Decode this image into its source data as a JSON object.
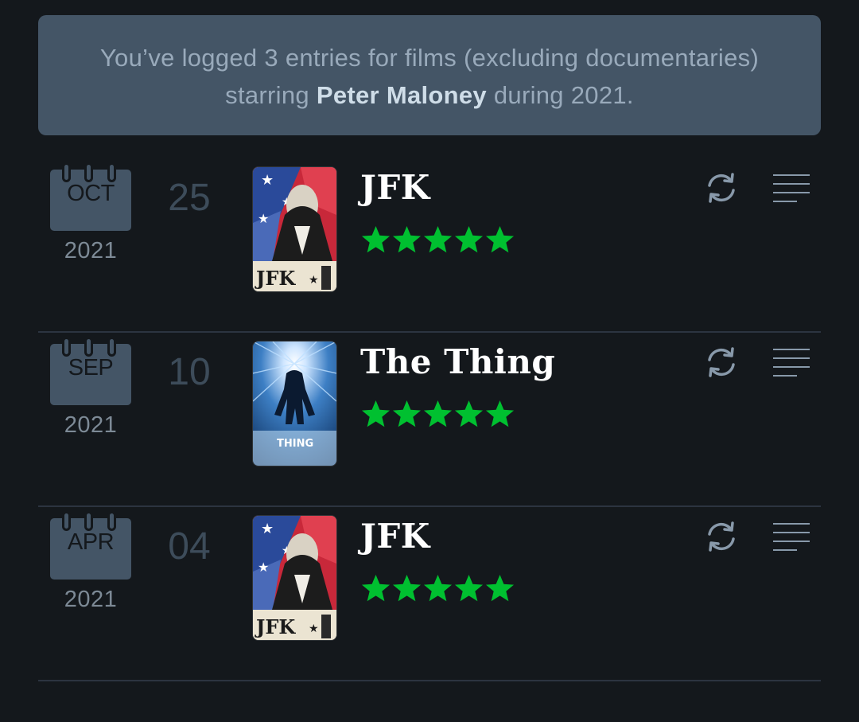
{
  "summary": {
    "before": "You’ve logged 3 entries for films (excluding documentaries) starring ",
    "actor": "Peter Maloney",
    "after": " during 2021."
  },
  "colors": {
    "background": "#14181c",
    "summary_bg": "#445566",
    "star_green": "#00c030",
    "icon_gray": "#8899aa"
  },
  "entries": [
    {
      "month": "OCT",
      "year": "2021",
      "day": "25",
      "title": "JFK",
      "rating": 5,
      "poster": "JFK poster",
      "icons": [
        "rewatch-icon",
        "review-icon"
      ]
    },
    {
      "month": "SEP",
      "year": "2021",
      "day": "10",
      "title": "The Thing",
      "rating": 5,
      "poster": "The Thing poster",
      "icons": [
        "rewatch-icon",
        "review-icon"
      ]
    },
    {
      "month": "APR",
      "year": "2021",
      "day": "04",
      "title": "JFK",
      "rating": 5,
      "poster": "JFK poster",
      "icons": [
        "rewatch-icon",
        "review-icon"
      ]
    }
  ]
}
